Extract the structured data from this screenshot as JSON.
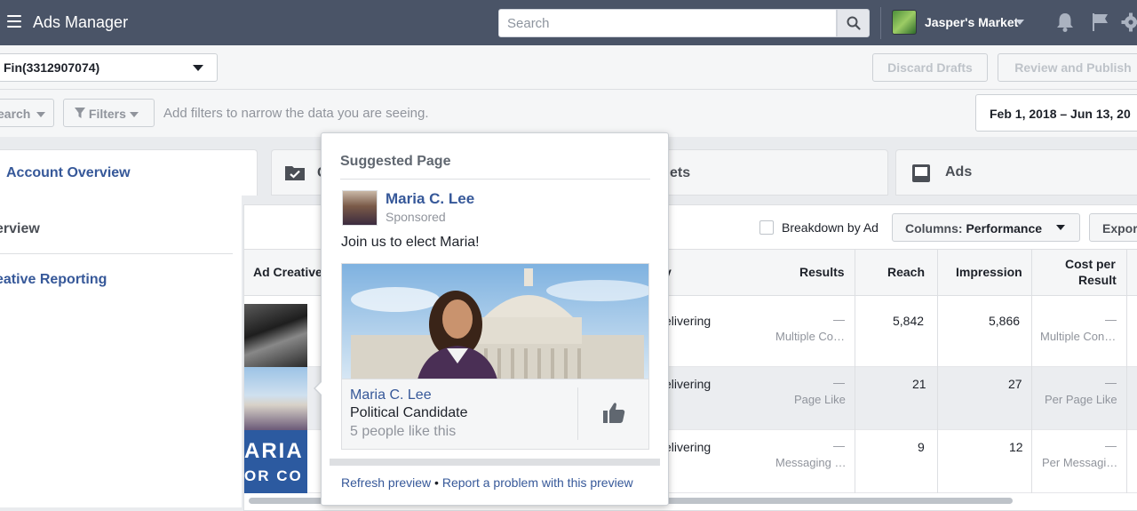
{
  "topbar": {
    "app_title": "Ads Manager",
    "search_placeholder": "Search",
    "account_name": "Jasper's Market"
  },
  "toolbar": {
    "account_select": "Fin(3312907074)",
    "discard_label": "Discard Drafts",
    "review_label": "Review and Publish"
  },
  "filters": {
    "search_label": "earch",
    "filters_label": "Filters",
    "hint": "Add filters to narrow the data you are seeing.",
    "date_range": "Feb 1, 2018 – Jun 13, 20"
  },
  "tabs": {
    "account": "Account Overview",
    "campaigns": "C",
    "adsets": "ets",
    "ads": "Ads"
  },
  "sidebar": {
    "items": [
      "erview",
      "eative Reporting"
    ]
  },
  "table_controls": {
    "breakdown_label": "Breakdown by Ad",
    "columns_prefix": "Columns:",
    "columns_value": "Performance",
    "export_label": "Expor"
  },
  "table": {
    "headers": {
      "ad_creative": "Ad Creative",
      "delivery": "y",
      "results": "Results",
      "reach": "Reach",
      "impressions": "Impression",
      "cost_per_result_1": "Cost per",
      "cost_per_result_2": "Result"
    },
    "rows": [
      {
        "delivery": "elivering",
        "results_dash": "—",
        "results_sub": "Multiple Co…",
        "reach": "5,842",
        "impressions": "5,866",
        "cost_dash": "—",
        "cost_sub": "Multiple Con…"
      },
      {
        "delivery": "elivering",
        "results_dash": "—",
        "results_sub": "Page Like",
        "reach": "21",
        "impressions": "27",
        "cost_dash": "—",
        "cost_sub": "Per Page Like"
      },
      {
        "delivery": "elivering",
        "results_dash": "—",
        "results_sub": "Messaging …",
        "reach": "9",
        "impressions": "12",
        "cost_dash": "—",
        "cost_sub": "Per Messagi…"
      }
    ],
    "thumb3_text_1": "ARIA",
    "thumb3_text_2": "OR CO"
  },
  "popover": {
    "title": "Suggested Page",
    "page_name": "Maria C. Lee",
    "sponsored": "Sponsored",
    "body": "Join us to elect Maria!",
    "card_name": "Maria C. Lee",
    "card_category": "Political Candidate",
    "card_likes": "5 people like this",
    "refresh_link": "Refresh preview",
    "bullet": "•",
    "report_link": "Report a problem with this preview"
  },
  "colors": {
    "topbar": "#4a5467",
    "link": "#365899",
    "muted": "#90949c"
  }
}
